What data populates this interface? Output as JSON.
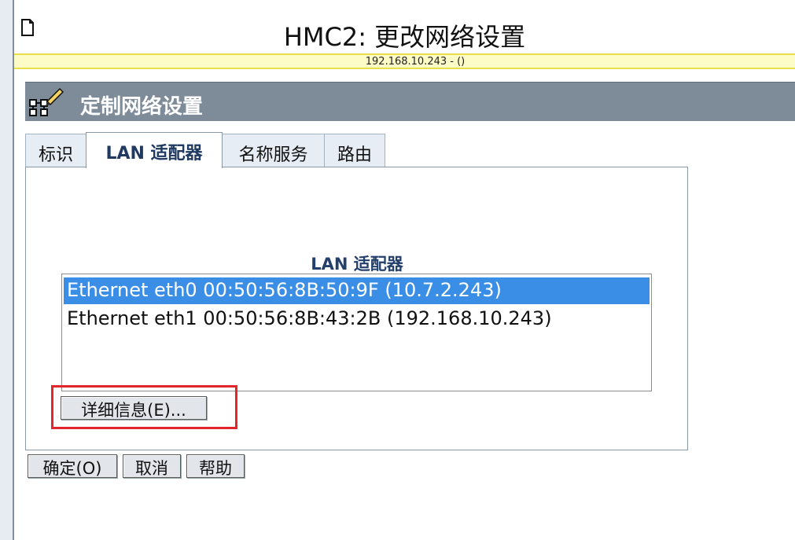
{
  "window": {
    "title": "HMC2: 更改网络设置"
  },
  "address_bar": {
    "text": "192.168.10.243  -  ()"
  },
  "header": {
    "title": "定制网络设置"
  },
  "tabs": [
    {
      "label": "标识"
    },
    {
      "label": "LAN 适配器"
    },
    {
      "label": "名称服务"
    },
    {
      "label": "路由"
    }
  ],
  "panel": {
    "heading": "LAN 适配器",
    "adapters": [
      {
        "text": "Ethernet eth0 00:50:56:8B:50:9F (10.7.2.243)",
        "selected": true
      },
      {
        "text": "Ethernet eth1 00:50:56:8B:43:2B (192.168.10.243)",
        "selected": false
      }
    ],
    "details_button": "详细信息(E)..."
  },
  "footer_buttons": {
    "ok": "确定(O)",
    "cancel": "取消",
    "help": "帮助"
  },
  "colors": {
    "header_band": "#7e8b98",
    "selection": "#3a8ee6",
    "highlight": "#e2262b",
    "address_bar": "#fdfbc6"
  }
}
